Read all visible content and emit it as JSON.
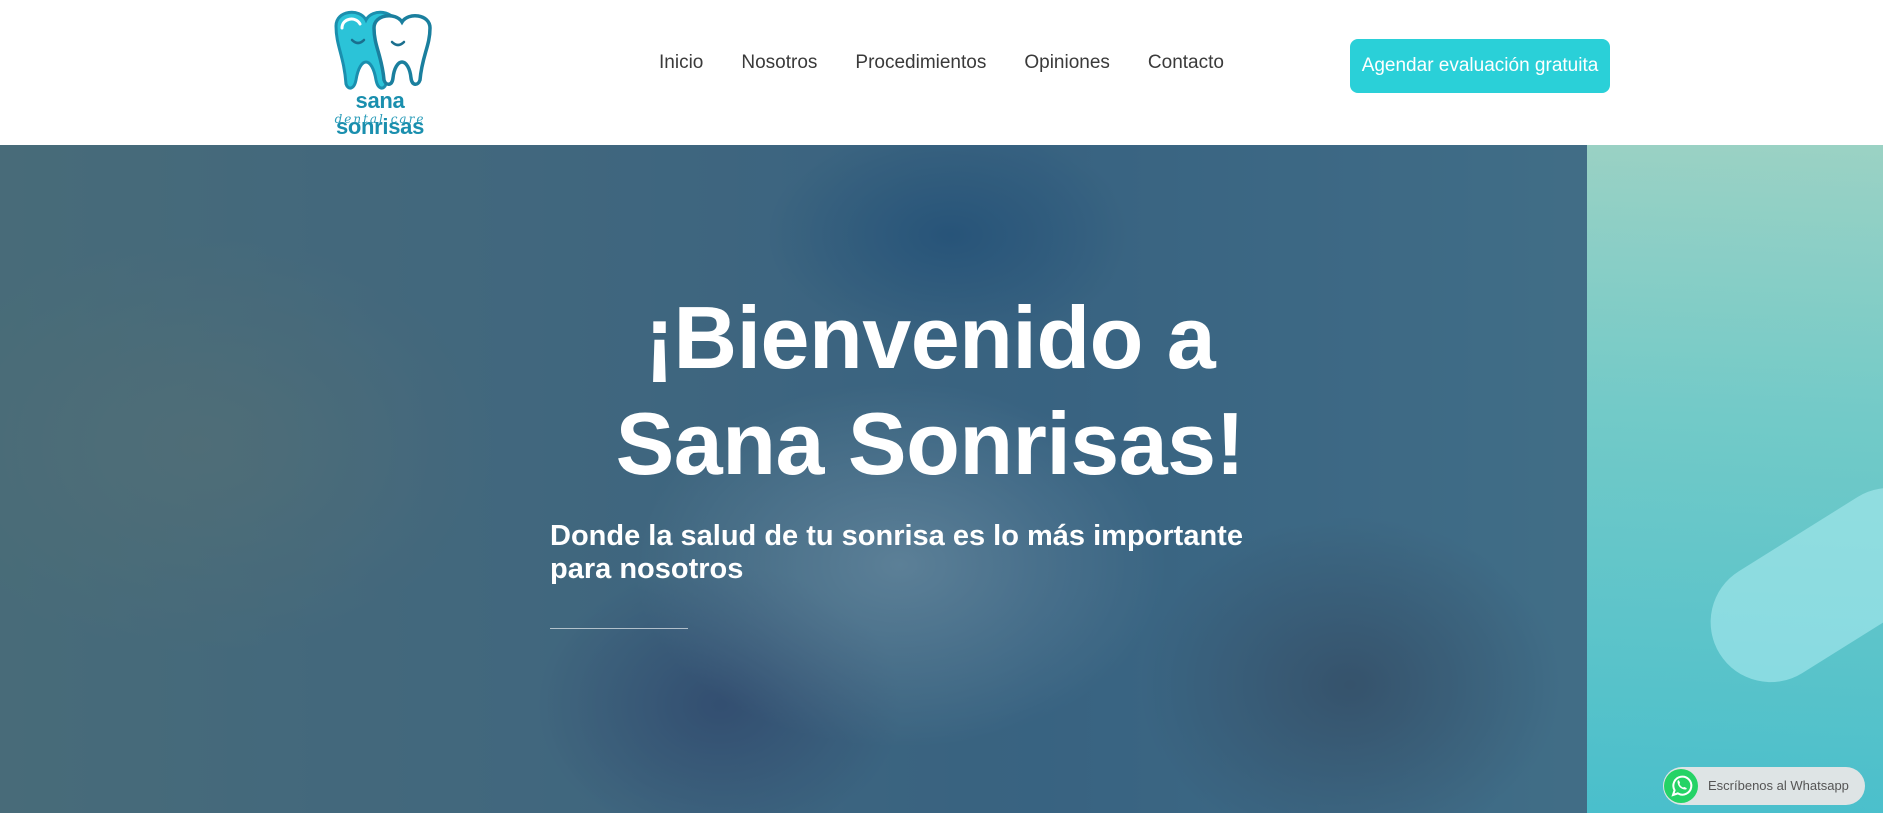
{
  "brand": {
    "name": "sana sonrisas",
    "tagline": "dental care",
    "logo_icon": "two-teeth-icon",
    "colors": {
      "primary": "#1a8fae",
      "accent": "#2ad0d8"
    }
  },
  "nav": {
    "items": [
      {
        "label": "Inicio"
      },
      {
        "label": "Nosotros"
      },
      {
        "label": "Procedimientos"
      },
      {
        "label": "Opiniones"
      },
      {
        "label": "Contacto"
      }
    ]
  },
  "cta": {
    "label": "Agendar evaluación gratuita"
  },
  "hero": {
    "title_line1": "¡Bienvenido a",
    "title_line2": "Sana Sonrisas!",
    "subtitle_line1": "Donde la salud de tu sonrisa es lo más importante",
    "subtitle_line2": "para nosotros"
  },
  "whatsapp": {
    "label": "Escríbenos al Whatsapp",
    "icon": "whatsapp-icon",
    "color": "#25d366"
  }
}
